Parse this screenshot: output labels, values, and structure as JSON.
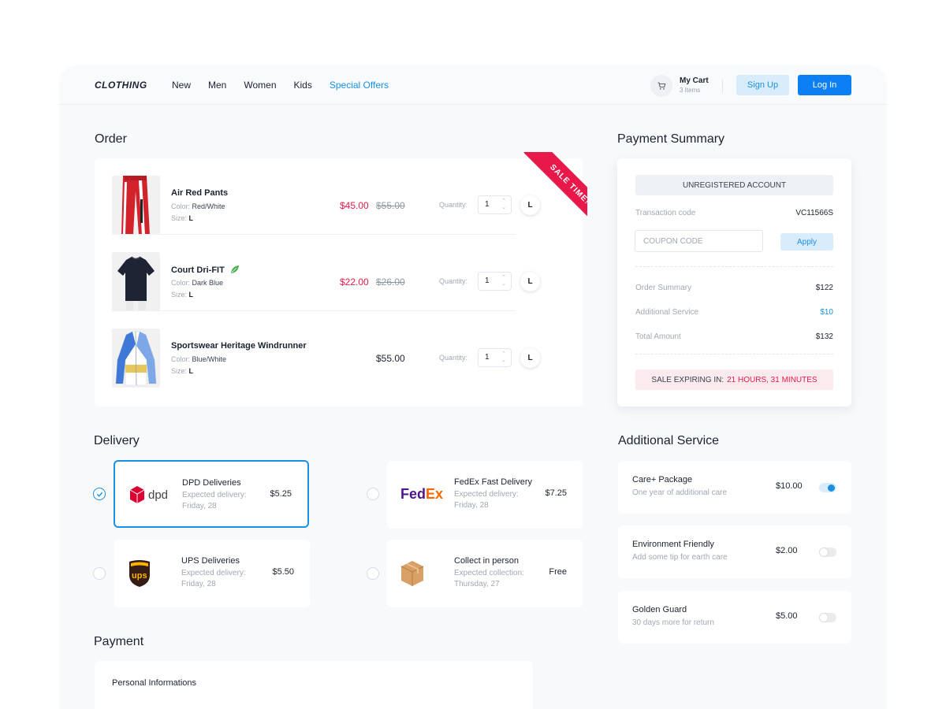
{
  "header": {
    "logo": "CLOTHING",
    "nav": [
      "New",
      "Men",
      "Women",
      "Kids",
      "Special Offers"
    ],
    "cart_title": "My Cart",
    "cart_count": "3 Items",
    "signup": "Sign Up",
    "login": "Log In"
  },
  "order": {
    "title": "Order",
    "ribbon": "SALE TIME!",
    "quantity_label": "Quantity:",
    "items": [
      {
        "name": "Air Red Pants",
        "color_label": "Color:",
        "color": "Red/White",
        "size_label": "Size:",
        "size": "L",
        "price": "$45.00",
        "old_price": "$55.00",
        "qty": "1",
        "size_btn": "L"
      },
      {
        "name": "Court Dri-FIT",
        "color_label": "Color:",
        "color": "Dark Blue",
        "size_label": "Size:",
        "size": "L",
        "price": "$22.00",
        "old_price": "$26.00",
        "qty": "1",
        "size_btn": "L"
      },
      {
        "name": "Sportswear Heritage Windrunner",
        "color_label": "Color:",
        "color": "Blue/White",
        "size_label": "Size:",
        "size": "L",
        "price": "$55.00",
        "old_price": "",
        "qty": "1",
        "size_btn": "L"
      }
    ]
  },
  "summary": {
    "title": "Payment Summary",
    "account": "UNREGISTERED ACCOUNT",
    "transaction_label": "Transaction code",
    "transaction_code": "VC11566S",
    "coupon_placeholder": "COUPON CODE",
    "apply": "Apply",
    "order_summary_label": "Order Summary",
    "order_summary": "$122",
    "additional_label": "Additional Service",
    "additional": "$10",
    "total_label": "Total Amount",
    "total": "$132",
    "expire_label": "SALE EXPIRING IN:",
    "expire_time": "21 HOURS, 31 MINUTES"
  },
  "delivery": {
    "title": "Delivery",
    "options": [
      {
        "name": "DPD Deliveries",
        "sub1": "Expected delivery:",
        "sub2": "Friday, 28",
        "price": "$5.25",
        "logo": "dpd",
        "selected": true
      },
      {
        "name": "FedEx Fast Delivery",
        "sub1": "Expected delivery:",
        "sub2": "Friday, 28",
        "price": "$7.25",
        "logo": "FedEx",
        "selected": false
      },
      {
        "name": "UPS Deliveries",
        "sub1": "Expected delivery:",
        "sub2": "Friday, 28",
        "price": "$5.50",
        "logo": "ups",
        "selected": false
      },
      {
        "name": "Collect in person",
        "sub1": "Expected collection:",
        "sub2": "Thursday, 27",
        "price": "Free",
        "logo": "box-icon",
        "selected": false
      }
    ]
  },
  "services": {
    "title": "Additional Service",
    "items": [
      {
        "name": "Care+ Package",
        "sub": "One year of additional care",
        "price": "$10.00",
        "enabled": true
      },
      {
        "name": "Environment Friendly",
        "sub": "Add some tip for earth care",
        "price": "$2.00",
        "enabled": false
      },
      {
        "name": "Golden Guard",
        "sub": "30 days more for return",
        "price": "$5.00",
        "enabled": false
      }
    ]
  },
  "payment": {
    "title": "Payment",
    "personal": "Personal Informations"
  },
  "colors": {
    "accent": "#0c7ff2",
    "sale": "#e8194a",
    "light_accent": "#d9ecfb"
  }
}
